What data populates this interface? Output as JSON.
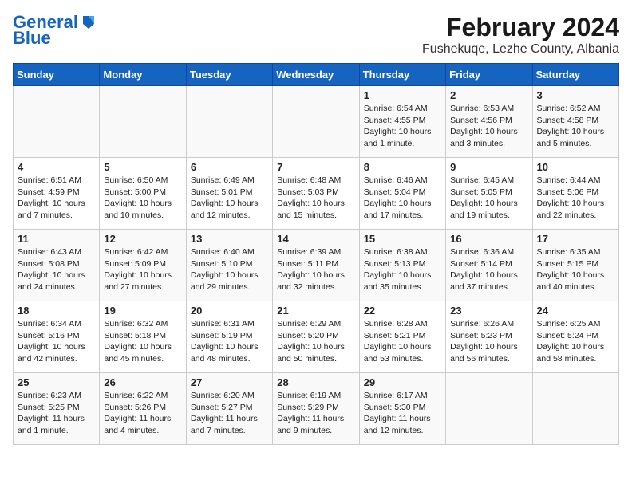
{
  "header": {
    "logo_line1": "General",
    "logo_line2": "Blue",
    "title": "February 2024",
    "subtitle": "Fushekuqe, Lezhe County, Albania"
  },
  "days_of_week": [
    "Sunday",
    "Monday",
    "Tuesday",
    "Wednesday",
    "Thursday",
    "Friday",
    "Saturday"
  ],
  "weeks": [
    [
      {
        "num": "",
        "info": ""
      },
      {
        "num": "",
        "info": ""
      },
      {
        "num": "",
        "info": ""
      },
      {
        "num": "",
        "info": ""
      },
      {
        "num": "1",
        "info": "Sunrise: 6:54 AM\nSunset: 4:55 PM\nDaylight: 10 hours\nand 1 minute."
      },
      {
        "num": "2",
        "info": "Sunrise: 6:53 AM\nSunset: 4:56 PM\nDaylight: 10 hours\nand 3 minutes."
      },
      {
        "num": "3",
        "info": "Sunrise: 6:52 AM\nSunset: 4:58 PM\nDaylight: 10 hours\nand 5 minutes."
      }
    ],
    [
      {
        "num": "4",
        "info": "Sunrise: 6:51 AM\nSunset: 4:59 PM\nDaylight: 10 hours\nand 7 minutes."
      },
      {
        "num": "5",
        "info": "Sunrise: 6:50 AM\nSunset: 5:00 PM\nDaylight: 10 hours\nand 10 minutes."
      },
      {
        "num": "6",
        "info": "Sunrise: 6:49 AM\nSunset: 5:01 PM\nDaylight: 10 hours\nand 12 minutes."
      },
      {
        "num": "7",
        "info": "Sunrise: 6:48 AM\nSunset: 5:03 PM\nDaylight: 10 hours\nand 15 minutes."
      },
      {
        "num": "8",
        "info": "Sunrise: 6:46 AM\nSunset: 5:04 PM\nDaylight: 10 hours\nand 17 minutes."
      },
      {
        "num": "9",
        "info": "Sunrise: 6:45 AM\nSunset: 5:05 PM\nDaylight: 10 hours\nand 19 minutes."
      },
      {
        "num": "10",
        "info": "Sunrise: 6:44 AM\nSunset: 5:06 PM\nDaylight: 10 hours\nand 22 minutes."
      }
    ],
    [
      {
        "num": "11",
        "info": "Sunrise: 6:43 AM\nSunset: 5:08 PM\nDaylight: 10 hours\nand 24 minutes."
      },
      {
        "num": "12",
        "info": "Sunrise: 6:42 AM\nSunset: 5:09 PM\nDaylight: 10 hours\nand 27 minutes."
      },
      {
        "num": "13",
        "info": "Sunrise: 6:40 AM\nSunset: 5:10 PM\nDaylight: 10 hours\nand 29 minutes."
      },
      {
        "num": "14",
        "info": "Sunrise: 6:39 AM\nSunset: 5:11 PM\nDaylight: 10 hours\nand 32 minutes."
      },
      {
        "num": "15",
        "info": "Sunrise: 6:38 AM\nSunset: 5:13 PM\nDaylight: 10 hours\nand 35 minutes."
      },
      {
        "num": "16",
        "info": "Sunrise: 6:36 AM\nSunset: 5:14 PM\nDaylight: 10 hours\nand 37 minutes."
      },
      {
        "num": "17",
        "info": "Sunrise: 6:35 AM\nSunset: 5:15 PM\nDaylight: 10 hours\nand 40 minutes."
      }
    ],
    [
      {
        "num": "18",
        "info": "Sunrise: 6:34 AM\nSunset: 5:16 PM\nDaylight: 10 hours\nand 42 minutes."
      },
      {
        "num": "19",
        "info": "Sunrise: 6:32 AM\nSunset: 5:18 PM\nDaylight: 10 hours\nand 45 minutes."
      },
      {
        "num": "20",
        "info": "Sunrise: 6:31 AM\nSunset: 5:19 PM\nDaylight: 10 hours\nand 48 minutes."
      },
      {
        "num": "21",
        "info": "Sunrise: 6:29 AM\nSunset: 5:20 PM\nDaylight: 10 hours\nand 50 minutes."
      },
      {
        "num": "22",
        "info": "Sunrise: 6:28 AM\nSunset: 5:21 PM\nDaylight: 10 hours\nand 53 minutes."
      },
      {
        "num": "23",
        "info": "Sunrise: 6:26 AM\nSunset: 5:23 PM\nDaylight: 10 hours\nand 56 minutes."
      },
      {
        "num": "24",
        "info": "Sunrise: 6:25 AM\nSunset: 5:24 PM\nDaylight: 10 hours\nand 58 minutes."
      }
    ],
    [
      {
        "num": "25",
        "info": "Sunrise: 6:23 AM\nSunset: 5:25 PM\nDaylight: 11 hours\nand 1 minute."
      },
      {
        "num": "26",
        "info": "Sunrise: 6:22 AM\nSunset: 5:26 PM\nDaylight: 11 hours\nand 4 minutes."
      },
      {
        "num": "27",
        "info": "Sunrise: 6:20 AM\nSunset: 5:27 PM\nDaylight: 11 hours\nand 7 minutes."
      },
      {
        "num": "28",
        "info": "Sunrise: 6:19 AM\nSunset: 5:29 PM\nDaylight: 11 hours\nand 9 minutes."
      },
      {
        "num": "29",
        "info": "Sunrise: 6:17 AM\nSunset: 5:30 PM\nDaylight: 11 hours\nand 12 minutes."
      },
      {
        "num": "",
        "info": ""
      },
      {
        "num": "",
        "info": ""
      }
    ]
  ]
}
